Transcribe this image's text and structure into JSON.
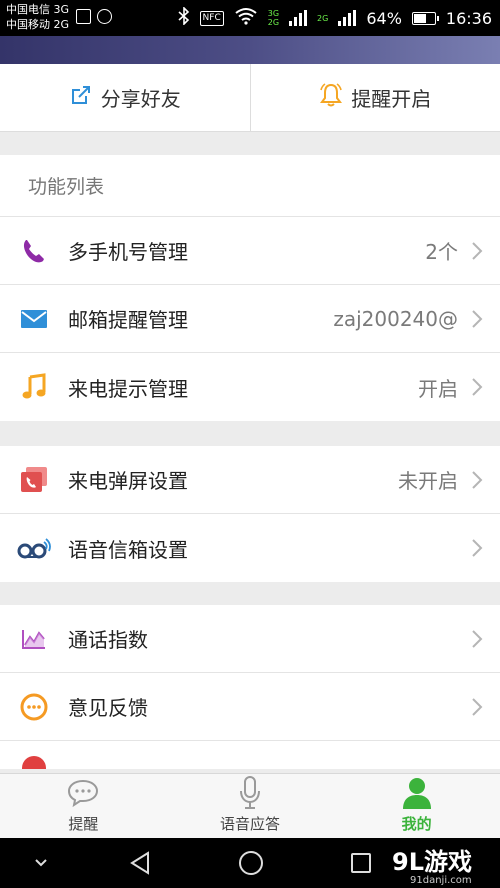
{
  "status_bar": {
    "carrier_1": "中国电信 3G",
    "carrier_2": "中国移动 2G",
    "nfc": "NFC",
    "net_3g": "3G",
    "net_2g_a": "2G",
    "net_2g_b": "2G",
    "battery_percent": "64%",
    "battery_level": 0.64,
    "time": "16:36"
  },
  "share_bar": {
    "share_label": "分享好友",
    "reminder_label": "提醒开启"
  },
  "function_list": {
    "title": "功能列表",
    "items": [
      {
        "label": "多手机号管理",
        "value": "2个",
        "icon": "phone-icon"
      },
      {
        "label": "邮箱提醒管理",
        "value": "zaj200240@",
        "icon": "mail-icon"
      },
      {
        "label": "来电提示管理",
        "value": "开启",
        "icon": "music-note-icon"
      }
    ]
  },
  "screen_settings": {
    "items": [
      {
        "label": "来电弹屏设置",
        "value": "未开启",
        "icon": "popup-phone-icon"
      },
      {
        "label": "语音信箱设置",
        "value": "",
        "icon": "voicemail-icon"
      }
    ]
  },
  "other": {
    "items": [
      {
        "label": "通话指数",
        "value": "",
        "icon": "chart-icon"
      },
      {
        "label": "意见反馈",
        "value": "",
        "icon": "feedback-icon"
      }
    ]
  },
  "tabs": [
    {
      "label": "提醒",
      "icon": "chat-bubble-icon",
      "active": false
    },
    {
      "label": "语音应答",
      "icon": "microphone-icon",
      "active": false
    },
    {
      "label": "我的",
      "icon": "person-icon",
      "active": true
    }
  ],
  "watermark": {
    "logo": "9L游戏",
    "url": "91danji.com"
  },
  "colors": {
    "accent_green": "#3cb33c",
    "phone_purple": "#8e2aa6",
    "mail_blue": "#2f8fd8",
    "note_orange": "#f5a623",
    "popup_red": "#e05050",
    "chart_purple": "#b04fc0",
    "feedback_orange": "#f59a23"
  }
}
